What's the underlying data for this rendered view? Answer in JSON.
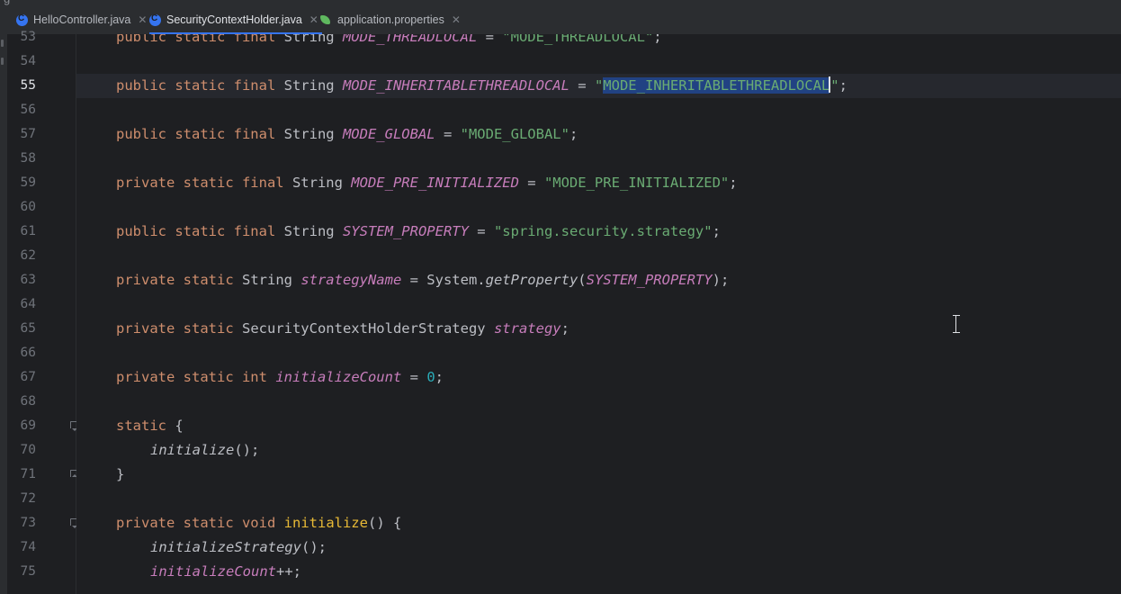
{
  "breadcrumb_hint": "g",
  "tabs": [
    {
      "label": "HelloController.java",
      "icon": "java-class-icon",
      "active": false
    },
    {
      "label": "SecurityContextHolder.java",
      "icon": "java-class-icon",
      "active": true
    },
    {
      "label": "application.properties",
      "icon": "spring-leaf-icon",
      "active": false
    }
  ],
  "gutter": {
    "line_numbers": [
      "53",
      "54",
      "55",
      "56",
      "57",
      "58",
      "59",
      "60",
      "61",
      "62",
      "63",
      "64",
      "65",
      "66",
      "67",
      "68",
      "69",
      "70",
      "71",
      "72",
      "73",
      "74",
      "75"
    ],
    "current_line": "55",
    "fold_markers": [
      "69",
      "71",
      "73"
    ],
    "intention_icon": "lightbulb-icon"
  },
  "code": {
    "l53": {
      "a": "public static final",
      "b": " String ",
      "c": "MODE_THREADLOCAL",
      "d": " = ",
      "e": "\"MODE_THREADLOCAL\"",
      "f": ";"
    },
    "l55": {
      "a": "public static final",
      "b": " String ",
      "c": "MODE_INHERITABLETHREADLOCAL",
      "d": " = ",
      "e1": "\"",
      "e2": "MODE_INHERITABLETHREADLOCAL",
      "e3": "\"",
      "f": ";"
    },
    "l57": {
      "a": "public static final",
      "b": " String ",
      "c": "MODE_GLOBAL",
      "d": " = ",
      "e": "\"MODE_GLOBAL\"",
      "f": ";"
    },
    "l59": {
      "a": "private static final",
      "b": " String ",
      "c": "MODE_PRE_INITIALIZED",
      "d": " = ",
      "e": "\"MODE_PRE_INITIALIZED\"",
      "f": ";"
    },
    "l61": {
      "a": "public static final",
      "b": " String ",
      "c": "SYSTEM_PROPERTY",
      "d": " = ",
      "e": "\"spring.security.strategy\"",
      "f": ";"
    },
    "l63": {
      "a": "private static",
      "b": " String ",
      "c": "strategyName",
      "d": " = System.",
      "e": "getProperty",
      "f": "(",
      "g": "SYSTEM_PROPERTY",
      "h": ");"
    },
    "l65": {
      "a": "private static",
      "b": " SecurityContextHolderStrategy ",
      "c": "strategy",
      "f": ";"
    },
    "l67": {
      "a": "private static int",
      "b": " ",
      "c": "initializeCount",
      "d": " = ",
      "e": "0",
      "f": ";"
    },
    "l69": {
      "a": "static",
      "b": " {"
    },
    "l70": {
      "a": "initialize",
      "b": "();"
    },
    "l71": {
      "a": "}"
    },
    "l73": {
      "a": "private static void",
      "b": " ",
      "c": "initialize",
      "d": "() {"
    },
    "l74": {
      "a": "initializeStrategy",
      "b": "();"
    },
    "l75": {
      "a": "initializeCount",
      "b": "++;"
    }
  }
}
